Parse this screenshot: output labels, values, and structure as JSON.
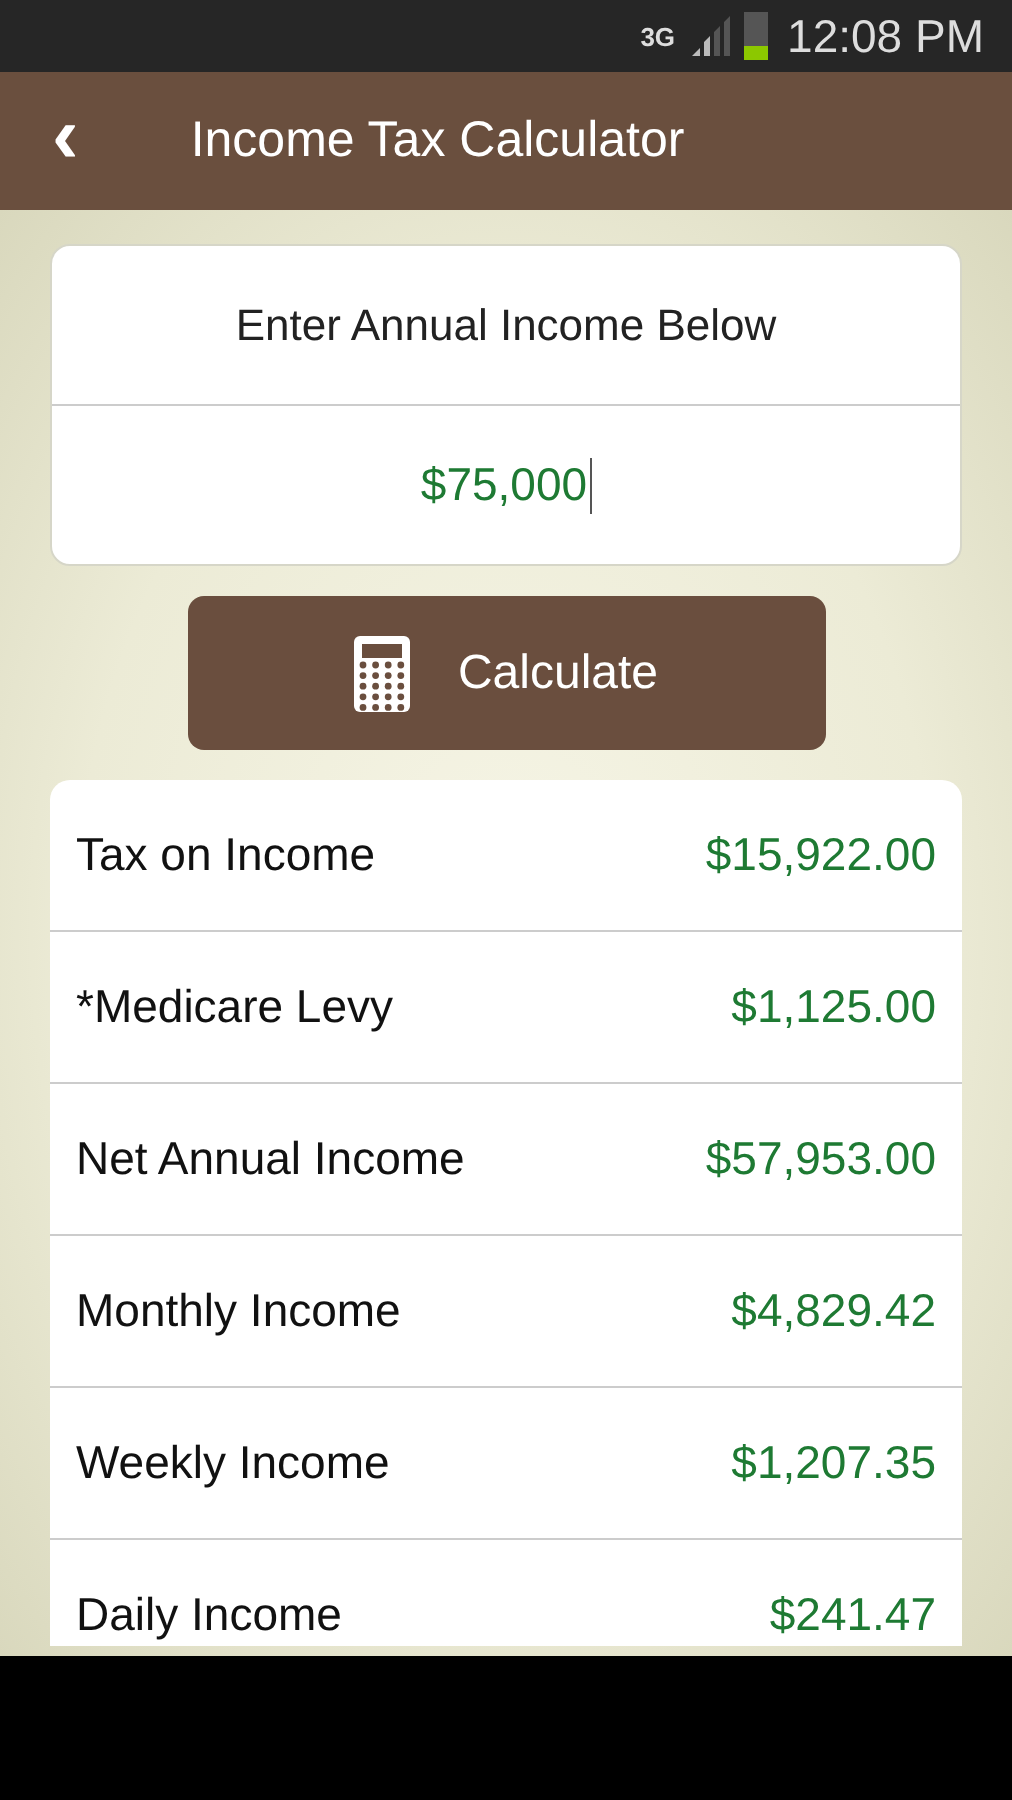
{
  "status_bar": {
    "network": "3G",
    "time": "12:08 PM"
  },
  "header": {
    "back": "‹",
    "title": "Income Tax Calculator"
  },
  "income_card": {
    "label": "Enter Annual Income Below",
    "value": "$75,000"
  },
  "calculate_button": {
    "label": "Calculate"
  },
  "results": [
    {
      "label": "Tax on Income",
      "value": "$15,922.00"
    },
    {
      "label": "*Medicare Levy",
      "value": "$1,125.00"
    },
    {
      "label": "Net Annual Income",
      "value": "$57,953.00"
    },
    {
      "label": "Monthly Income",
      "value": "$4,829.42"
    },
    {
      "label": "Weekly Income",
      "value": "$1,207.35"
    },
    {
      "label": "Daily Income",
      "value": "$241.47"
    }
  ]
}
